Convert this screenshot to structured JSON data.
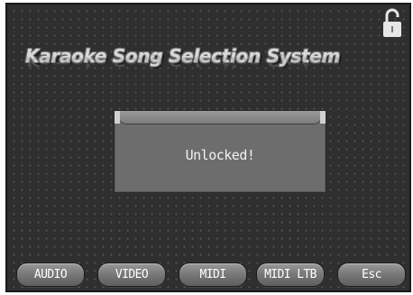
{
  "header": {
    "title": "Karaoke Song Selection System",
    "lock_icon": "unlocked-padlock-icon"
  },
  "dialog": {
    "message": "Unlocked!"
  },
  "toolbar": {
    "audio_label": "AUDIO",
    "video_label": "VIDEO",
    "midi_label": "MIDI",
    "midi_ltb_label": "MIDI LTB",
    "esc_label": "Esc"
  },
  "colors": {
    "background": "#2f2f2f",
    "dialog": "#6d6d6d",
    "button": "#7a7a7a",
    "text": "#ffffff"
  }
}
